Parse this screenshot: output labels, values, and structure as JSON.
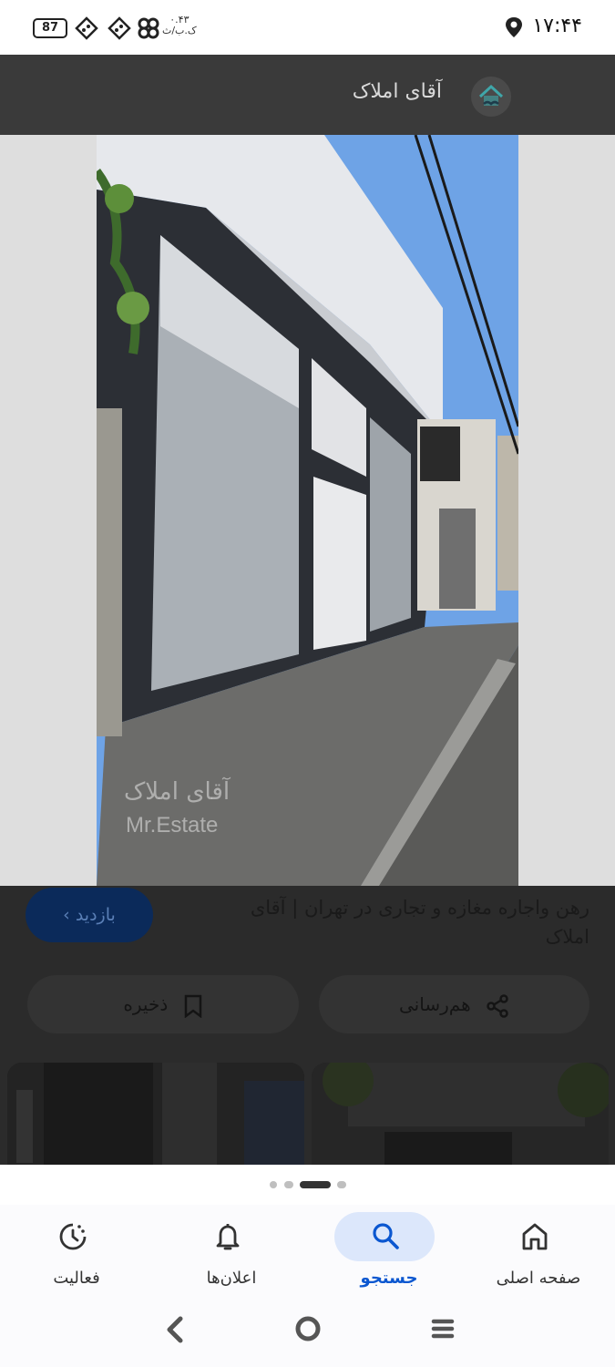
{
  "status_bar": {
    "time": "۱۷:۴۴",
    "battery": "87",
    "net_speed_value": "۰.۴۳",
    "net_speed_unit": "ک.ب/ث"
  },
  "header": {
    "title": "آقای املاک"
  },
  "watermark": {
    "fa": "آقای املاک",
    "en": "Mr.Estate"
  },
  "result": {
    "title": "رهن واجاره مغازه و تجاری در تهران | آقای املاک",
    "visit_label": "بازدید"
  },
  "actions": {
    "share_label": "هم‌رسانی",
    "save_label": "ذخیره"
  },
  "bottom_nav": {
    "items": [
      {
        "label": "صفحه اصلی",
        "icon": "home-icon"
      },
      {
        "label": "جستجو",
        "icon": "search-icon"
      },
      {
        "label": "اعلان‌ها",
        "icon": "bell-icon"
      },
      {
        "label": "فعالیت",
        "icon": "activity-icon"
      }
    ]
  },
  "colors": {
    "accent": "#0b57d0",
    "accent_pill": "#dce7fb",
    "overlay_bg": "#2b2b2b"
  }
}
